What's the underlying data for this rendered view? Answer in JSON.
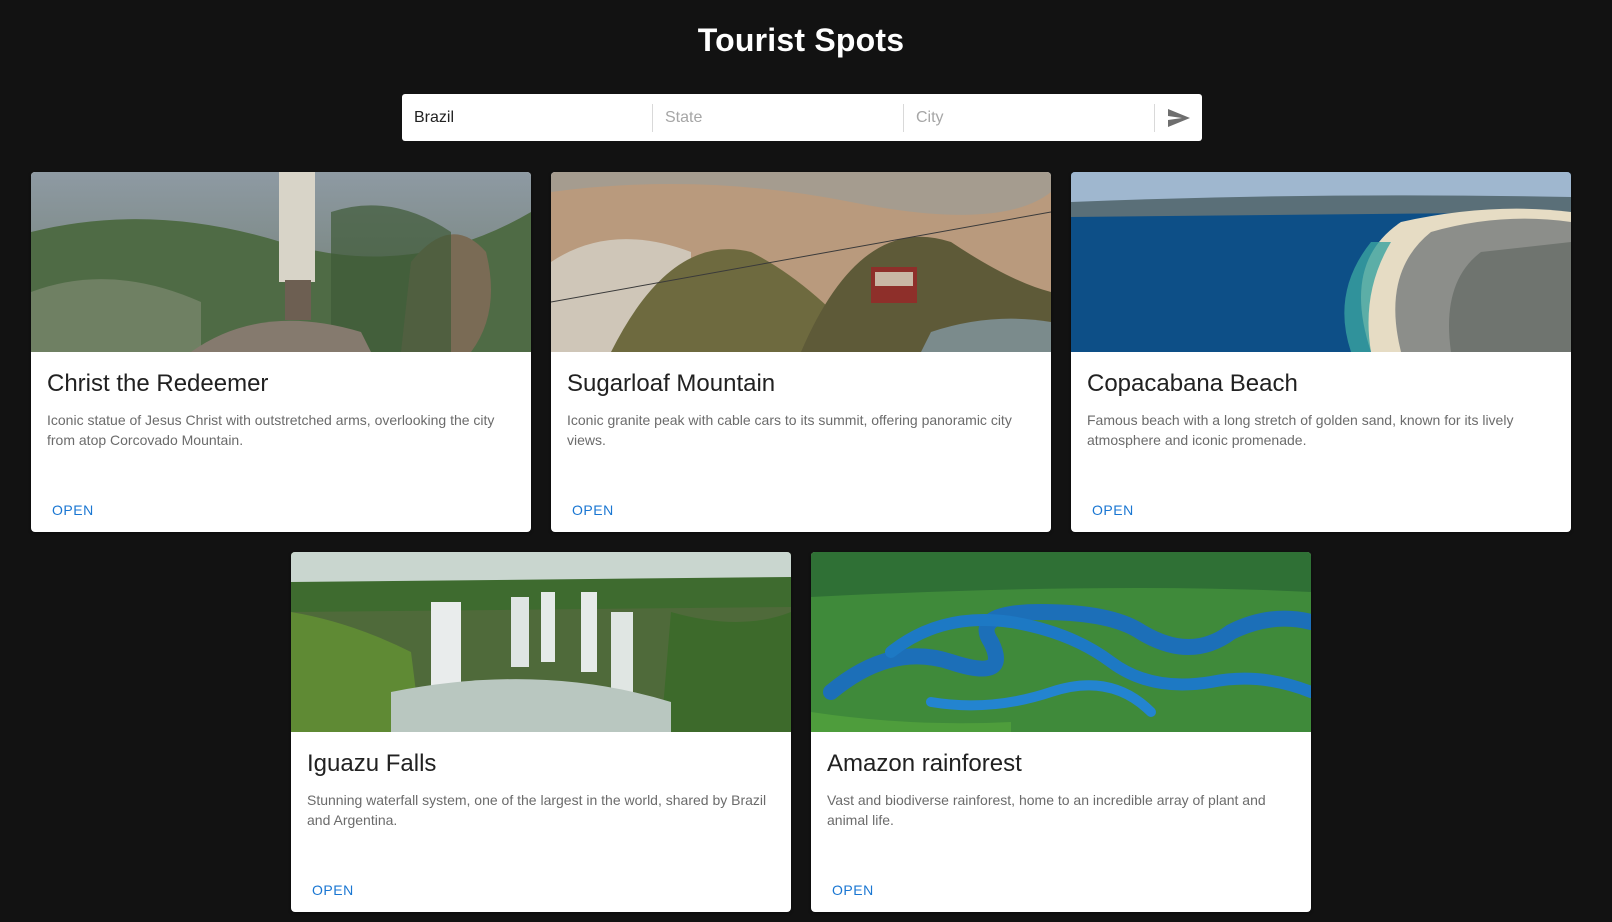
{
  "header": {
    "title": "Tourist Spots"
  },
  "search": {
    "country_value": "Brazil",
    "state_placeholder": "State",
    "city_placeholder": "City",
    "submit_icon": "send-icon"
  },
  "colors": {
    "background": "#121212",
    "card": "#ffffff",
    "action": "#1976d2"
  },
  "cards": [
    {
      "title": "Christ the Redeemer",
      "description": "Iconic statue of Jesus Christ with outstretched arms, overlooking the city from atop Corcovado Mountain.",
      "action": "OPEN"
    },
    {
      "title": "Sugarloaf Mountain",
      "description": "Iconic granite peak with cable cars to its summit, offering panoramic city views.",
      "action": "OPEN"
    },
    {
      "title": "Copacabana Beach",
      "description": "Famous beach with a long stretch of golden sand, known for its lively atmosphere and iconic promenade.",
      "action": "OPEN"
    },
    {
      "title": "Iguazu Falls",
      "description": "Stunning waterfall system, one of the largest in the world, shared by Brazil and Argentina.",
      "action": "OPEN"
    },
    {
      "title": "Amazon rainforest",
      "description": "Vast and biodiverse rainforest, home to an incredible array of plant and animal life.",
      "action": "OPEN"
    }
  ]
}
